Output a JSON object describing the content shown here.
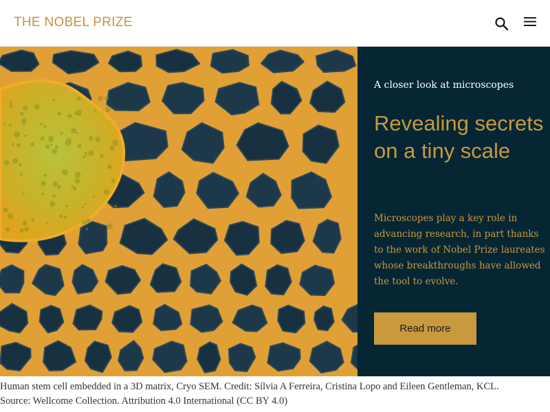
{
  "header": {
    "logo": "THE NOBEL PRIZE",
    "search_icon": "search-icon",
    "menu_icon": "hamburger-menu-icon"
  },
  "hero": {
    "eyebrow": "A closer look at microscopes",
    "title": "Revealing secrets on a tiny scale",
    "body": "Microscopes play a key role in advancing research, in part thanks to the work of Nobel Prize laureates whose breakthroughs have allowed the tool to evolve.",
    "button_label": "Read more"
  },
  "caption": {
    "line1": "Human stem cell embedded in a 3D matrix, Cryo SEM. Credit: Sílvia A Ferreira, Cristina Lopo and Eileen Gentleman, KCL.",
    "line2": "Source: Wellcome Collection. Attribution 4.0 International (CC BY 4.0)"
  },
  "colors": {
    "accent_gold": "#c8993f",
    "panel_navy": "#062634",
    "logo_gold": "#c5943a"
  }
}
